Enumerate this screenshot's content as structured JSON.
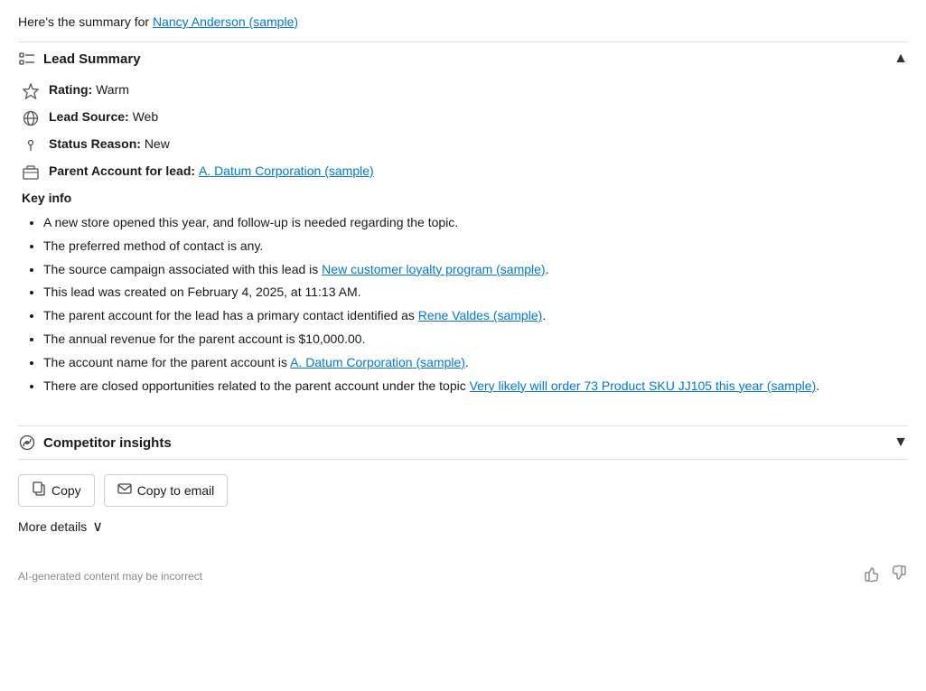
{
  "intro": {
    "text_before_link": "Here's the summary for ",
    "link_text": "Nancy Anderson (sample)"
  },
  "lead_summary": {
    "section_title": "Lead Summary",
    "chevron": "▲",
    "fields": [
      {
        "icon": "star",
        "label": "Rating:",
        "value": "Warm"
      },
      {
        "icon": "target",
        "label": "Lead Source:",
        "value": "Web"
      },
      {
        "icon": "lightbulb",
        "label": "Status Reason:",
        "value": "New"
      },
      {
        "icon": "building",
        "label": "Parent Account for lead:",
        "value": "",
        "link": "A. Datum Corporation (sample)"
      }
    ],
    "key_info_title": "Key info",
    "key_info_items": [
      {
        "text": "A new store opened this year, and follow-up is needed regarding the topic.",
        "has_link": false,
        "link_text": "",
        "text_before": "",
        "text_after": ""
      },
      {
        "text": "The preferred method of contact is any.",
        "has_link": false
      },
      {
        "text_before": "The source campaign associated with this lead is ",
        "has_link": true,
        "link_text": "New customer loyalty program (sample)",
        "text_after": "."
      },
      {
        "text": "This lead was created on February 4, 2025, at 11:13 AM.",
        "has_link": false
      },
      {
        "text_before": "The parent account for the lead has a primary contact identified as ",
        "has_link": true,
        "link_text": "Rene Valdes (sample)",
        "text_after": "."
      },
      {
        "text": "The annual revenue for the parent account is $10,000.00.",
        "has_link": false
      },
      {
        "text_before": "The account name for the parent account is ",
        "has_link": true,
        "link_text": "A. Datum Corporation (sample)",
        "text_after": "."
      },
      {
        "text_before": "There are closed opportunities related to the parent account under the topic ",
        "has_link": true,
        "link_text": "Very likely will order 73 Product SKU JJ105 this year (sample)",
        "text_after": "."
      }
    ]
  },
  "competitor_insights": {
    "section_title": "Competitor insights",
    "chevron": "▼"
  },
  "buttons": {
    "copy_label": "Copy",
    "copy_to_email_label": "Copy to email"
  },
  "more_details": {
    "label": "More details",
    "chevron": "∨"
  },
  "footer": {
    "disclaimer": "AI-generated content may be incorrect",
    "thumbs_up": "👍",
    "thumbs_down": "👎"
  }
}
